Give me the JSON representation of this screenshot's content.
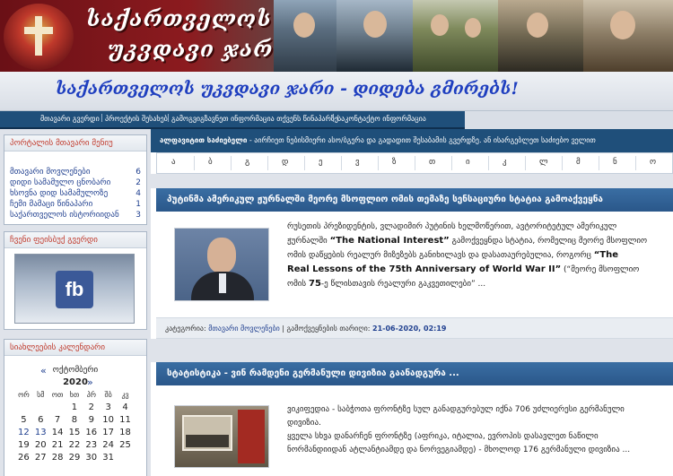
{
  "header": {
    "title_line1": "საქართველოს",
    "title_line2": "უკვდავი ჯარი"
  },
  "slogan": "საქართველოს უკვდავი ჯარი - დიდება გმირებს!",
  "topnav": {
    "items": [
      "მთავარი გვერდი",
      "პროექტის შესახებ",
      "გამოგვიგზავნეთ ინფორმაცია თქვენს წინაპარზე",
      "საკონტაქტო ინფორმაცია"
    ]
  },
  "sidebar": {
    "menu_title": "პორტალის მთავარი მენიუ",
    "menu_items": [
      {
        "label": "მთავარი მოვლენები",
        "count": "6"
      },
      {
        "label": "დიდი სამამულო ცნობარი",
        "count": "2"
      },
      {
        "label": "ხსოვნა დიდ სამამულოზე",
        "count": "4"
      },
      {
        "label": "ჩემი მამაცი წინაპარი",
        "count": "1"
      },
      {
        "label": "საქართველოს ისტორიიდან",
        "count": "3"
      }
    ],
    "fb_title": "ჩვენი ფეისბუქ გვერდი",
    "fb_logo": "fb",
    "calendar_title": "სიახლეების კალენდარი",
    "calendar": {
      "prev": "«",
      "month": "ოქტომბერი",
      "next": "»",
      "year": "2020",
      "weekdays": [
        "ორ",
        "სმ",
        "ოთ",
        "ხთ",
        "პრ",
        "შბ",
        "კვ"
      ],
      "weeks": [
        [
          "",
          "",
          "",
          "1",
          "2",
          "3",
          "4"
        ],
        [
          "5",
          "6",
          "7",
          "8",
          "9",
          "10",
          "11"
        ],
        [
          "12",
          "13",
          "14",
          "15",
          "16",
          "17",
          "18"
        ],
        [
          "19",
          "20",
          "21",
          "22",
          "23",
          "24",
          "25"
        ],
        [
          "26",
          "27",
          "28",
          "29",
          "30",
          "31",
          ""
        ]
      ],
      "linked_days": [
        "12",
        "13"
      ]
    }
  },
  "main": {
    "alpha_title": "ალფავიტით საძიებელი",
    "alpha_hint": " - აირჩიეთ ნებისმიერი ასო/ბგერა და გადადით შესაბამის გვერდზე. ან ისარგებლეთ საძიებო ველით",
    "letters": [
      "ა",
      "ბ",
      "გ",
      "დ",
      "ე",
      "ვ",
      "ზ",
      "თ",
      "ი",
      "კ",
      "ლ",
      "მ",
      "ნ",
      "ო"
    ],
    "articles": [
      {
        "title": "პუტინმა ამერიკულ ჟურნალში მეორე მსოფლიო ომის თემაზე სენსაციური სტატია გამოაქვეყნა",
        "text_1": "რუსეთის პრეზიდენტის, ვლადიმირ პუტინის ხელმოწერით, ავტორიტეტულ ამერიკულ",
        "text_2": "ჟურნალში",
        "bold_1": "“The National Interest”",
        "text_3": " გამოქვეყნდა სტატია, რომელიც მეორე მსოფლიო",
        "text_4": "ომის დაწყების რეალურ მიზეზებს განიხილავს და დასათაურებულია, როგორც",
        "bold_2": "“The",
        "bold_3": "Real Lessons of the 75th Anniversary of World War II”",
        "text_5": " (“მეორე მსოფლიო",
        "text_6": "ომის ",
        "bold_4": "75",
        "text_7": "-ე წლისთავის რეალური გაკვეთილები” ...",
        "category_label": "კატეგორია: ",
        "category": "მთავარი მოვლენები",
        "date_label": " | გამოქვეყნების თარიღი: ",
        "date": "21-06-2020, 02:19"
      },
      {
        "title": "სტატისტიკა - ვინ რამდენი გერმანული დივიზია გაანადგურა ...",
        "text_1": "ვიკიფედია - საბჭოთა ფრონტზე სულ განადგურებულ იქნა 706 უძლიერესი გერმანული",
        "text_2": "დივიზია.",
        "text_3": "ყველა სხვა დანარჩენ ფრონტზე (აფრიკა, იტალია, ევროპის დასავლეთ ნაწილი",
        "text_4": "ნორმანდიიდან ატლანტიამდე და ნორვეგიამდე) - მხოლოდ 176 გერმანული დივიზია ..."
      }
    ]
  },
  "colors": {
    "nav_blue": "#1f4f7a",
    "article_header": "#2a578a",
    "slogan_blue": "#1f3fbf",
    "menu_title_red": "#c0392b"
  }
}
